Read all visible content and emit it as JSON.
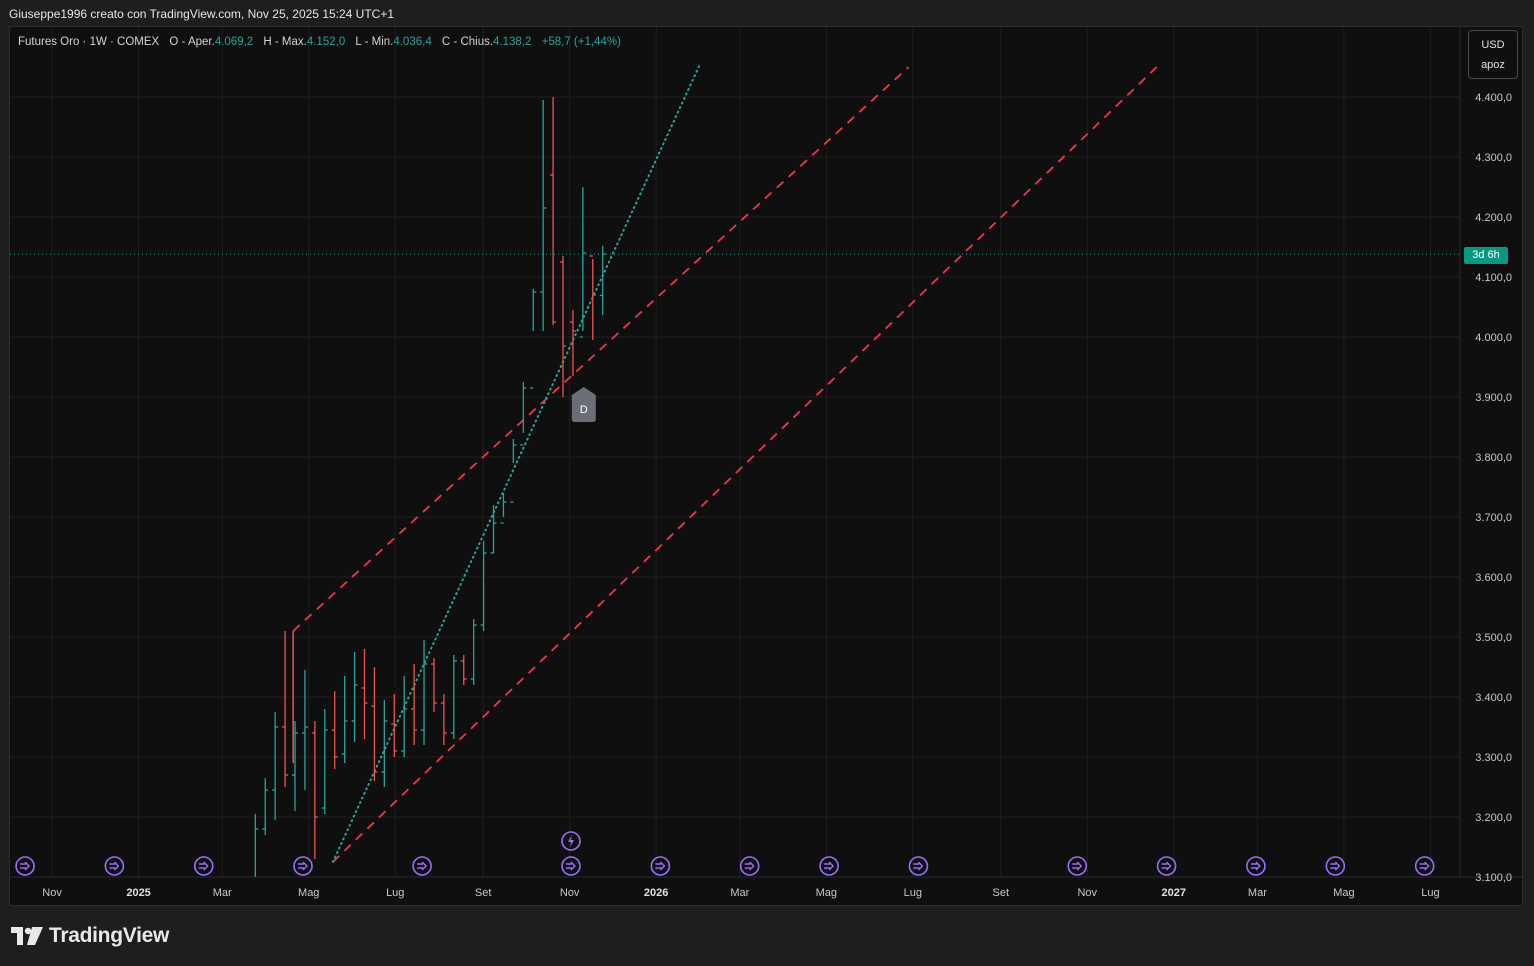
{
  "header": {
    "attribution": "Giuseppe1996 creato con TradingView.com, Nov 25, 2025 15:24 UTC+1"
  },
  "legend": {
    "symbol": "Futures Oro · 1W · COMEX",
    "open_label": "O - Aper.",
    "open_value": "4.069,2",
    "high_label": "H - Max.",
    "high_value": "4.152,0",
    "low_label": "L - Min.",
    "low_value": "4.036,4",
    "close_label": "C - Chius.",
    "close_value": "4.138,2",
    "change": "+58,7 (+1,44%)"
  },
  "currency": {
    "code": "USD",
    "setting": "apoz"
  },
  "countdown": "3d 6h",
  "marker": {
    "letter": "D"
  },
  "logo": {
    "text": "TradingView"
  },
  "colors": {
    "up": "#26a69a",
    "down": "#ef5350",
    "trendline": "#f23645",
    "event": "#9c6cff",
    "background": "#0f0f0f",
    "grid": "#1f1f1f"
  },
  "chart_data": {
    "type": "ohlc",
    "interval": "1W",
    "currency": "USD",
    "ylim": [
      3100,
      4450
    ],
    "y_ticks": [
      "4.400,0",
      "4.300,0",
      "4.200,0",
      "4.100,0",
      "4.000,0",
      "3.900,0",
      "3.800,0",
      "3.700,0",
      "3.600,0",
      "3.500,0",
      "3.400,0",
      "3.300,0",
      "3.200,0",
      "3.100,0"
    ],
    "x_labels": [
      "Nov",
      "2025",
      "Mar",
      "Mag",
      "Lug",
      "Set",
      "Nov",
      "2026",
      "Mar",
      "Mag",
      "Lug",
      "Set",
      "Nov",
      "2027",
      "Mar",
      "Mag",
      "Lug"
    ],
    "bars": [
      {
        "date": "2025-04-06",
        "o": 3040,
        "h": 3205,
        "l": 3030,
        "c": 3180
      },
      {
        "date": "2025-04-13",
        "o": 3180,
        "h": 3265,
        "l": 3170,
        "c": 3245
      },
      {
        "date": "2025-04-20",
        "o": 3245,
        "h": 3375,
        "l": 3195,
        "c": 3350
      },
      {
        "date": "2025-04-27",
        "o": 3350,
        "h": 3510,
        "l": 3250,
        "c": 3270
      },
      {
        "date": "2025-05-04",
        "o": 3270,
        "h": 3360,
        "l": 3210,
        "c": 3340
      },
      {
        "date": "2025-05-11",
        "o": 3340,
        "h": 3445,
        "l": 3245,
        "c": 3350
      },
      {
        "date": "2025-05-18",
        "o": 3340,
        "h": 3360,
        "l": 3130,
        "c": 3200
      },
      {
        "date": "2025-05-25",
        "o": 3215,
        "h": 3380,
        "l": 3205,
        "c": 3345
      },
      {
        "date": "2025-06-01",
        "o": 3345,
        "h": 3410,
        "l": 3280,
        "c": 3300
      },
      {
        "date": "2025-06-08",
        "o": 3305,
        "h": 3435,
        "l": 3290,
        "c": 3360
      },
      {
        "date": "2025-06-15",
        "o": 3360,
        "h": 3475,
        "l": 3325,
        "c": 3420
      },
      {
        "date": "2025-06-22",
        "o": 3415,
        "h": 3480,
        "l": 3330,
        "c": 3390
      },
      {
        "date": "2025-06-29",
        "o": 3385,
        "h": 3450,
        "l": 3260,
        "c": 3275
      },
      {
        "date": "2025-07-06",
        "o": 3275,
        "h": 3395,
        "l": 3250,
        "c": 3360
      },
      {
        "date": "2025-07-13",
        "o": 3355,
        "h": 3405,
        "l": 3300,
        "c": 3310
      },
      {
        "date": "2025-07-20",
        "o": 3310,
        "h": 3435,
        "l": 3300,
        "c": 3380
      },
      {
        "date": "2025-07-27",
        "o": 3380,
        "h": 3455,
        "l": 3320,
        "c": 3345
      },
      {
        "date": "2025-08-03",
        "o": 3345,
        "h": 3495,
        "l": 3320,
        "c": 3455
      },
      {
        "date": "2025-08-10",
        "o": 3455,
        "h": 3465,
        "l": 3375,
        "c": 3390
      },
      {
        "date": "2025-08-17",
        "o": 3390,
        "h": 3405,
        "l": 3320,
        "c": 3340
      },
      {
        "date": "2025-08-24",
        "o": 3340,
        "h": 3470,
        "l": 3330,
        "c": 3460
      },
      {
        "date": "2025-08-31",
        "o": 3460,
        "h": 3470,
        "l": 3420,
        "c": 3430
      },
      {
        "date": "2025-09-07",
        "o": 3430,
        "h": 3530,
        "l": 3420,
        "c": 3520
      },
      {
        "date": "2025-09-14",
        "o": 3520,
        "h": 3660,
        "l": 3510,
        "c": 3640
      },
      {
        "date": "2025-09-21",
        "o": 3640,
        "h": 3720,
        "l": 3640,
        "c": 3690
      },
      {
        "date": "2025-09-28",
        "o": 3690,
        "h": 3740,
        "l": 3700,
        "c": 3725
      },
      {
        "date": "2025-10-05",
        "o": 3725,
        "h": 3830,
        "l": 3790,
        "c": 3820
      },
      {
        "date": "2025-10-12",
        "o": 3820,
        "h": 3925,
        "l": 3840,
        "c": 3915
      },
      {
        "date": "2025-10-19",
        "o": 3915,
        "h": 4080,
        "l": 4010,
        "c": 4075
      },
      {
        "date": "2025-10-26",
        "o": 4075,
        "h": 4395,
        "l": 4010,
        "c": 4215
      },
      {
        "date": "2025-11-02",
        "o": 4270,
        "h": 4400,
        "l": 4020,
        "c": 4025
      },
      {
        "date": "2025-11-09",
        "o": 4125,
        "h": 4135,
        "l": 3900,
        "c": 3985
      },
      {
        "date": "2025-11-16",
        "o": 4025,
        "h": 4045,
        "l": 3935,
        "c": 4010
      },
      {
        "date": "2025-11-23",
        "o": 4000,
        "h": 4250,
        "l": 4010,
        "c": 4140
      },
      {
        "date": "2025-11-30",
        "o": 4135,
        "h": 4130,
        "l": 3995,
        "c": 4070
      },
      {
        "date": "2025-12-07",
        "o": 4069.2,
        "h": 4152.0,
        "l": 4036.4,
        "c": 4138.2
      }
    ],
    "last_price": 4138.2,
    "trendlines": [
      {
        "style": "dashed",
        "color": "#f23645",
        "from": {
          "date": "2025-04-20",
          "price": 3510
        },
        "to": {
          "date": "2026-06-28",
          "price": 4450
        }
      },
      {
        "style": "dashed",
        "color": "#f23645",
        "from": {
          "date": "2025-05-18",
          "price": 3125
        },
        "to": {
          "date": "2026-12-20",
          "price": 4450
        }
      },
      {
        "style": "dotted",
        "color": "#26a69a",
        "from": {
          "date": "2025-05-18",
          "price": 3125
        },
        "to": {
          "date": "2026-02-01",
          "price": 4455
        }
      }
    ],
    "events_at": [
      "2024-10-20",
      "2024-12-22",
      "2025-02-23",
      "2025-05-04",
      "2025-07-27",
      "2025-11-09",
      "2026-01-11",
      "2026-03-15",
      "2026-05-10",
      "2026-07-12",
      "2026-11-01",
      "2027-01-03",
      "2027-03-07",
      "2027-05-02",
      "2027-07-04"
    ],
    "event_special": {
      "date": "2025-11-09"
    },
    "d_marker_date": "2025-11-30"
  }
}
